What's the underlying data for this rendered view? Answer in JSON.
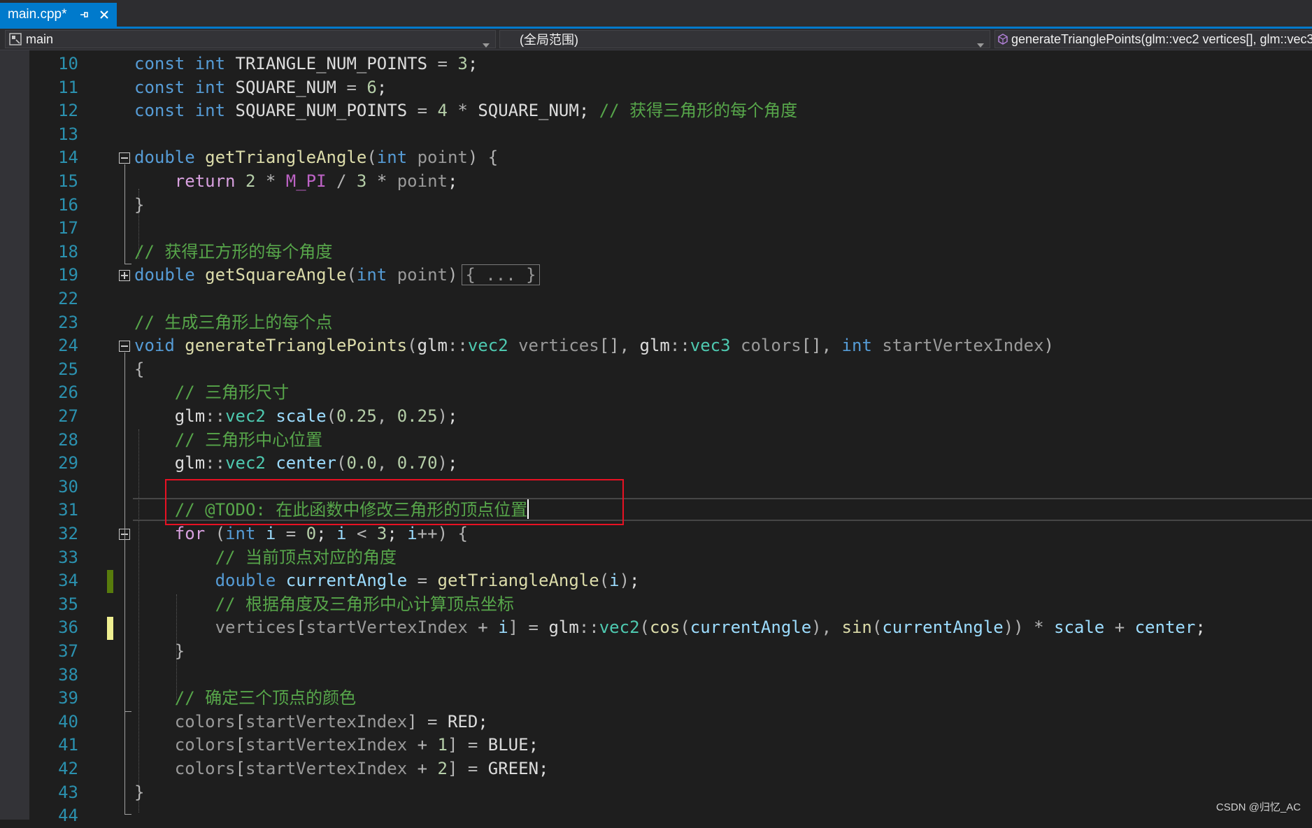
{
  "tab": {
    "name": "main.cpp*"
  },
  "nav": {
    "project": "main",
    "scope": "(全局范围)",
    "member": "generateTrianglePoints(glm::vec2 vertices[], glm::vec3 colors[], int startVertexIndex)"
  },
  "line_numbers": [
    "10",
    "11",
    "12",
    "13",
    "14",
    "15",
    "16",
    "17",
    "18",
    "19",
    "22",
    "23",
    "24",
    "25",
    "26",
    "27",
    "28",
    "29",
    "30",
    "31",
    "32",
    "33",
    "34",
    "35",
    "36",
    "37",
    "38",
    "39",
    "40",
    "41",
    "42",
    "43",
    "44"
  ],
  "code": {
    "l10_name": "TRIANGLE_NUM_POINTS",
    "l10_val": "3",
    "l11_name": "SQUARE_NUM",
    "l11_val": "6",
    "l12_name": "SQUARE_NUM_POINTS",
    "l12_val": "4",
    "l12_ref": "SQUARE_NUM",
    "l12_comment": "// 获得三角形的每个角度",
    "l14_fn": "getTriangleAngle",
    "l14_param": "point",
    "l15_num1": "2",
    "l15_macro": "M_PI",
    "l15_num2": "3",
    "l15_param": "point",
    "l18_comment": "// 获得正方形的每个角度",
    "l19_fn": "getSquareAngle",
    "l19_param": "point",
    "l19_collapsed": "{ ... }",
    "l23_comment": "// 生成三角形上的每个点",
    "l24_fn": "generateTrianglePoints",
    "l24_ns1": "glm",
    "l24_t1": "vec2",
    "l24_p1": "vertices",
    "l24_ns2": "glm",
    "l24_t2": "vec3",
    "l24_p2": "colors",
    "l24_p3": "startVertexIndex",
    "l26_comment": "// 三角形尺寸",
    "l27_ns": "glm",
    "l27_t": "vec2",
    "l27_var": "scale",
    "l27_a": "0.25",
    "l27_b": "0.25",
    "l28_comment": "// 三角形中心位置",
    "l29_ns": "glm",
    "l29_t": "vec2",
    "l29_var": "center",
    "l29_a": "0.0",
    "l29_b": "0.70",
    "l31_comment": "// @TODO: 在此函数中修改三角形的顶点位置",
    "l32_var": "i",
    "l32_init": "0",
    "l32_lim": "3",
    "l33_comment": "// 当前顶点对应的角度",
    "l34_var": "currentAngle",
    "l34_fn": "getTriangleAngle",
    "l34_arg": "i",
    "l35_comment": "// 根据角度及三角形中心计算顶点坐标",
    "l36_arr": "vertices",
    "l36_idx": "startVertexIndex",
    "l36_i": "i",
    "l36_ns": "glm",
    "l36_t": "vec2",
    "l36_cos": "cos",
    "l36_a1": "currentAngle",
    "l36_sin": "sin",
    "l36_a2": "currentAngle",
    "l36_scale": "scale",
    "l36_center": "center",
    "l39_comment": "// 确定三个顶点的颜色",
    "l40_arr": "colors",
    "l40_idx": "startVertexIndex",
    "l40_val": "RED",
    "l41_arr": "colors",
    "l41_idx": "startVertexIndex",
    "l41_n": "1",
    "l41_val": "BLUE",
    "l42_arr": "colors",
    "l42_idx": "startVertexIndex",
    "l42_n": "2",
    "l42_val": "GREEN"
  },
  "watermark": "CSDN @归忆_AC",
  "colors": {
    "accent": "#007acc",
    "highlight_box": "#e81123",
    "change_saved": "#587c0c",
    "change_unsaved": "#efef91"
  },
  "icons": [
    "pin-icon",
    "close-icon",
    "project-icon",
    "dropdown-arrow-icon",
    "member-icon"
  ]
}
